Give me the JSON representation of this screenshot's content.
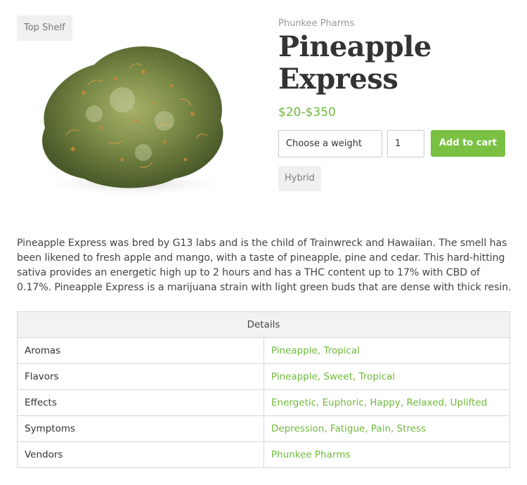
{
  "product": {
    "shelf_badge": "Top Shelf",
    "vendor": "Phunkee Pharms",
    "title": "Pineapple Express",
    "price": "$20-$350",
    "weight_select": "Choose a weight",
    "quantity": "1",
    "add_to_cart": "Add to cart",
    "type_badge": "Hybrid",
    "image_icon": "cannabis-bud-photo"
  },
  "description": "Pineapple Express was bred by G13 labs and is the child of Trainwreck and Hawaiian. The smell has been likened to fresh apple and mango, with a taste of pineapple, pine and cedar. This hard-hitting sativa provides an energetic high up to 2 hours and has a THC content up to 17% with CBD of 0.17%. Pineapple Express is a marijuana strain with light green buds that are dense with thick resin.",
  "details": {
    "header": "Details",
    "rows": [
      {
        "key": "Aromas",
        "value": "Pineapple, Tropical"
      },
      {
        "key": "Flavors",
        "value": "Pineapple, Sweet, Tropical"
      },
      {
        "key": "Effects",
        "value": "Energetic, Euphoric, Happy, Relaxed, Uplifted"
      },
      {
        "key": "Symptoms",
        "value": "Depression, Fatigue, Pain, Stress"
      },
      {
        "key": "Vendors",
        "value": "Phunkee Pharms"
      }
    ]
  },
  "colors": {
    "accent": "#7ac143",
    "link_green": "#6fba3a",
    "badge_bg": "#f0f0f0"
  }
}
